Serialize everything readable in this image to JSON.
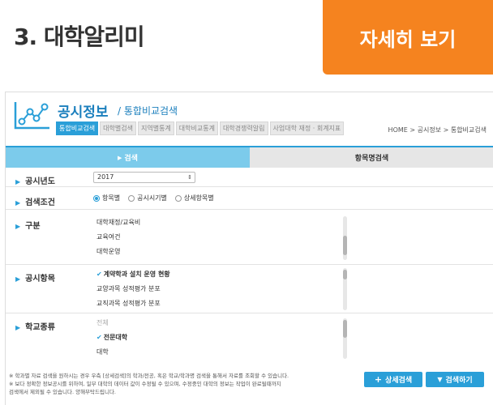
{
  "header": {
    "title": "3. 대학알리미",
    "detail_button": "자세히 보기"
  },
  "panel": {
    "title": "공시정보",
    "subtitle": "/ 통합비교검색",
    "subtabs": [
      "통합비교검색",
      "대학별검색",
      "지역별통계",
      "대학비교통계",
      "대학경쟁력알림",
      "사업대학 재정 · 회계지표"
    ],
    "breadcrumb": "HOME > 공시정보 > 통합비교검색",
    "tabs": [
      "검색",
      "항목명검색"
    ],
    "rows": {
      "year": {
        "label": "공시년도",
        "value": "2017"
      },
      "condition": {
        "label": "검색조건",
        "options": [
          "항목별",
          "공시시기별",
          "상세항목별"
        ]
      },
      "category": {
        "label": "구분",
        "items": [
          "대학재정/교육비",
          "교육여건",
          "대학운영"
        ]
      },
      "items": {
        "label": "공시항목",
        "items": [
          "계약학과 설치 운영 현황",
          "교양과목 성적평가 분포",
          "교직과목 성적평가 분포"
        ]
      },
      "school": {
        "label": "학교종류",
        "items": [
          "전체",
          "전문대학",
          "대학"
        ]
      }
    },
    "notes": [
      "※ 학과별 자료 검색을 원하시는 경우 우측 [상세검색]의 학과/전공, 혹은 학교/학과명 검색을 통해서 자료를 조회할 수 있습니다.",
      "※ 보다 정확한 정보공시를 위하여, 일부 대학의 데이터 값이 수정될 수 있으며, 수정중인 대학의 정보는 작업이 완료될때까지",
      "검색에서 제외될 수 있습니다. 양해부탁드립니다."
    ],
    "buttons": {
      "detail_search": "상세검색",
      "search": "검색하기"
    }
  },
  "colors": {
    "accent": "#2a9fd8",
    "orange": "#f5831f"
  }
}
